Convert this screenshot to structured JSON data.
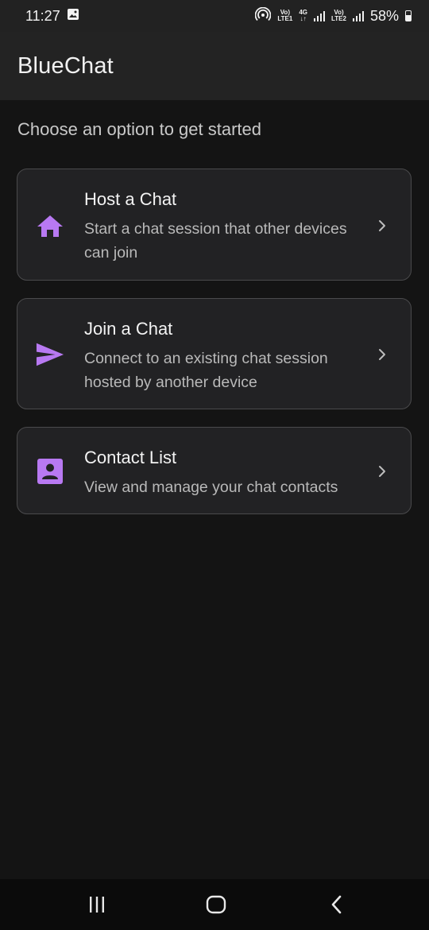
{
  "status": {
    "time": "11:27",
    "volte1_top": "Vo)",
    "volte1_bottom": "LTE1",
    "net_top": "4G",
    "net_bottom": "↓↑",
    "volte2_top": "Vo)",
    "volte2_bottom": "LTE2",
    "battery": "58%"
  },
  "app": {
    "title": "BlueChat"
  },
  "main": {
    "subtitle": "Choose an option to get started",
    "options": [
      {
        "icon": "home-icon",
        "title": "Host a Chat",
        "description": "Start a chat session that other devices can join"
      },
      {
        "icon": "send-icon",
        "title": "Join a Chat",
        "description": "Connect to an existing chat session hosted by another device"
      },
      {
        "icon": "contact-icon",
        "title": "Contact List",
        "description": "View and manage your chat contacts"
      }
    ]
  },
  "colors": {
    "accent": "#b879f2",
    "background": "#141414",
    "card": "#222224",
    "app_bar": "#232323"
  },
  "nav": {
    "recents": "recents-icon",
    "home": "home-outline-icon",
    "back": "back-icon"
  }
}
